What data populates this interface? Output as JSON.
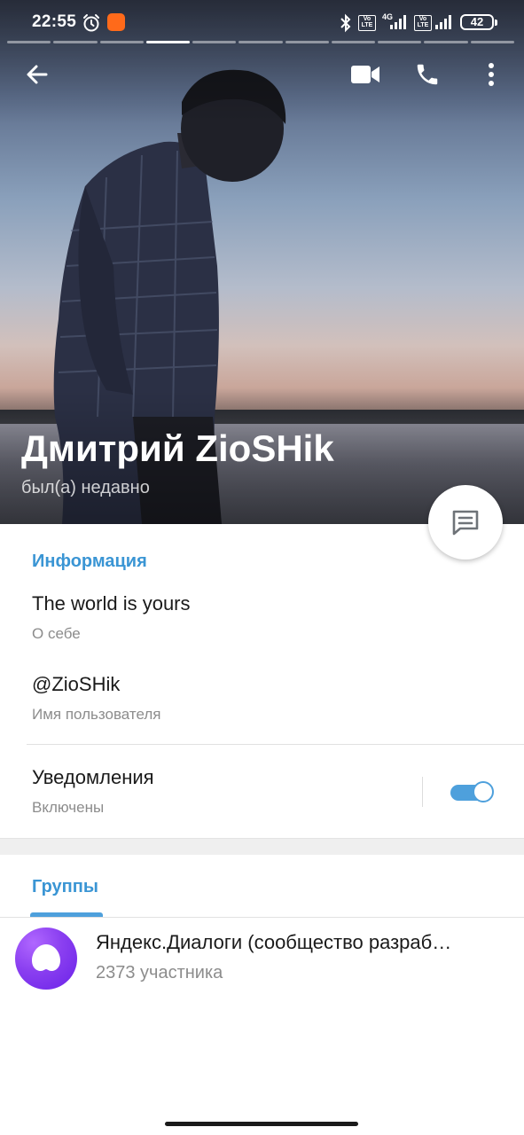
{
  "status_bar": {
    "time": "22:55",
    "network_1": "4G",
    "battery": "42"
  },
  "story_segments": {
    "total": 11,
    "active_index": 3
  },
  "toolbar": {
    "back_icon": "arrow-left-icon",
    "video_icon": "video-camera-icon",
    "call_icon": "phone-icon",
    "more_icon": "more-vertical-icon"
  },
  "profile": {
    "name": "Дмитрий ZioSHik",
    "status": "был(а) недавно",
    "message_fab_icon": "message-icon"
  },
  "info": {
    "section_title": "Информация",
    "bio": "The world is yours",
    "bio_label": "О себе",
    "username": "@ZioSHik",
    "username_label": "Имя пользователя",
    "notifications": "Уведомления",
    "notifications_state": "Включены",
    "notifications_enabled": true
  },
  "groups": {
    "tab_title": "Группы",
    "items": [
      {
        "name": "Яндекс.Диалоги (сообщество разраб…",
        "members": "2373 участника",
        "avatar_color": "#8a3ff0"
      }
    ]
  },
  "colors": {
    "accent": "#3a95d4",
    "toggle": "#4ea0dc"
  }
}
